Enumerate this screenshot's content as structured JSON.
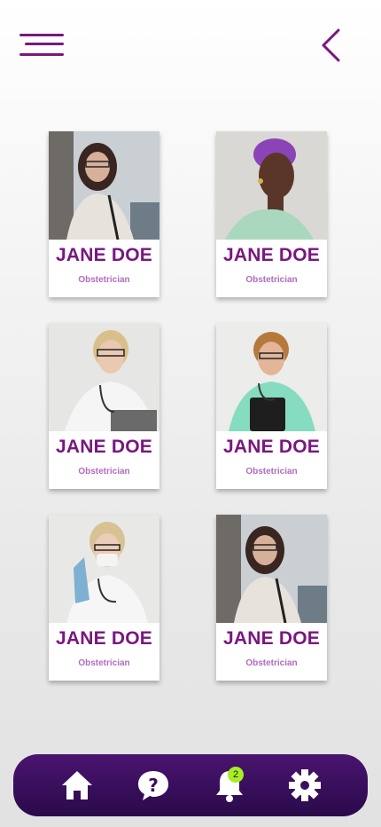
{
  "header": {
    "menu_icon": "hamburger-menu-icon",
    "back_icon": "chevron-left-icon"
  },
  "doctors": [
    {
      "name": "JANE DOE",
      "role": "Obstetrician",
      "photo": "woman-with-glasses-and-stethoscope"
    },
    {
      "name": "JANE DOE",
      "role": "Obstetrician",
      "photo": "woman-with-purple-hair"
    },
    {
      "name": "JANE DOE",
      "role": "Obstetrician",
      "photo": "blonde-doctor-adjusting-glasses"
    },
    {
      "name": "JANE DOE",
      "role": "Obstetrician",
      "photo": "doctor-in-green-scrubs"
    },
    {
      "name": "JANE DOE",
      "role": "Obstetrician",
      "photo": "doctor-with-mask-and-gloves"
    },
    {
      "name": "JANE DOE",
      "role": "Obstetrician",
      "photo": "woman-with-glasses-and-stethoscope"
    }
  ],
  "nav": {
    "items": [
      "home-icon",
      "help-icon",
      "notification-bell-icon",
      "settings-gear-icon"
    ],
    "notification_count": "2"
  },
  "colors": {
    "accent": "#7a1680",
    "subtext": "#b06cbf",
    "nav_bg": "#3a0f5e",
    "badge": "#a6ee1f"
  }
}
